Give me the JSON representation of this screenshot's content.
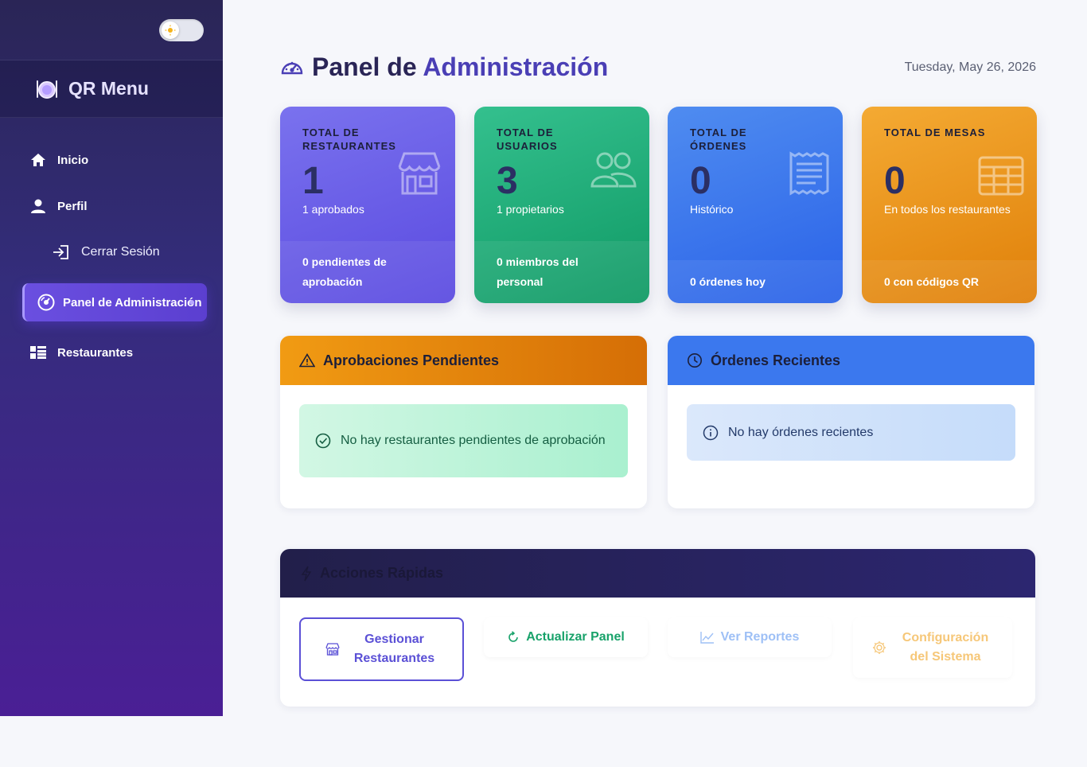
{
  "brand": {
    "name": "QR Menu"
  },
  "sidebar": {
    "items": [
      {
        "label": "Inicio",
        "icon": "home-icon"
      },
      {
        "label": "Perfil",
        "icon": "user-icon"
      },
      {
        "label": "Cerrar Sesión",
        "icon": "logout-icon"
      },
      {
        "label": "Panel de Administración",
        "icon": "dashboard-icon",
        "active": true
      },
      {
        "label": "Restaurantes",
        "icon": "list-icon"
      }
    ]
  },
  "header": {
    "title_part1": "Panel de",
    "title_part2": "Administración",
    "date": "Tuesday, May 26, 2026"
  },
  "stats": [
    {
      "title": "TOTAL DE RESTAURANTES",
      "value": "1",
      "sub": "1 aprobados",
      "footer": "0 pendientes de aprobación",
      "icon": "store-icon",
      "color": "#6a5ee8"
    },
    {
      "title": "TOTAL DE USUARIOS",
      "value": "3",
      "sub": "1 propietarios",
      "footer": "0 miembros del personal",
      "icon": "users-icon",
      "color": "#1fae78"
    },
    {
      "title": "TOTAL DE ÓRDENES",
      "value": "0",
      "sub": "Histórico",
      "footer": "0 órdenes hoy",
      "icon": "receipt-icon",
      "color": "#3b78ee"
    },
    {
      "title": "TOTAL DE MESAS",
      "value": "0",
      "sub": "En todos los restaurantes",
      "footer": "0 con códigos QR",
      "icon": "table-icon",
      "color": "#ee9620"
    }
  ],
  "pending": {
    "title": "Aprobaciones Pendientes",
    "message": "No hay restaurantes pendientes de aprobación"
  },
  "orders": {
    "title": "Órdenes Recientes",
    "message": "No hay órdenes recientes"
  },
  "quick_actions": {
    "title": "Acciones Rápidas",
    "buttons": [
      {
        "label": "Gestionar Restaurantes",
        "icon": "store-icon"
      },
      {
        "label": "Actualizar Panel",
        "icon": "refresh-icon"
      },
      {
        "label": "Ver Reportes",
        "icon": "chart-icon"
      },
      {
        "label": "Configuración del Sistema",
        "icon": "gear-icon"
      }
    ]
  }
}
